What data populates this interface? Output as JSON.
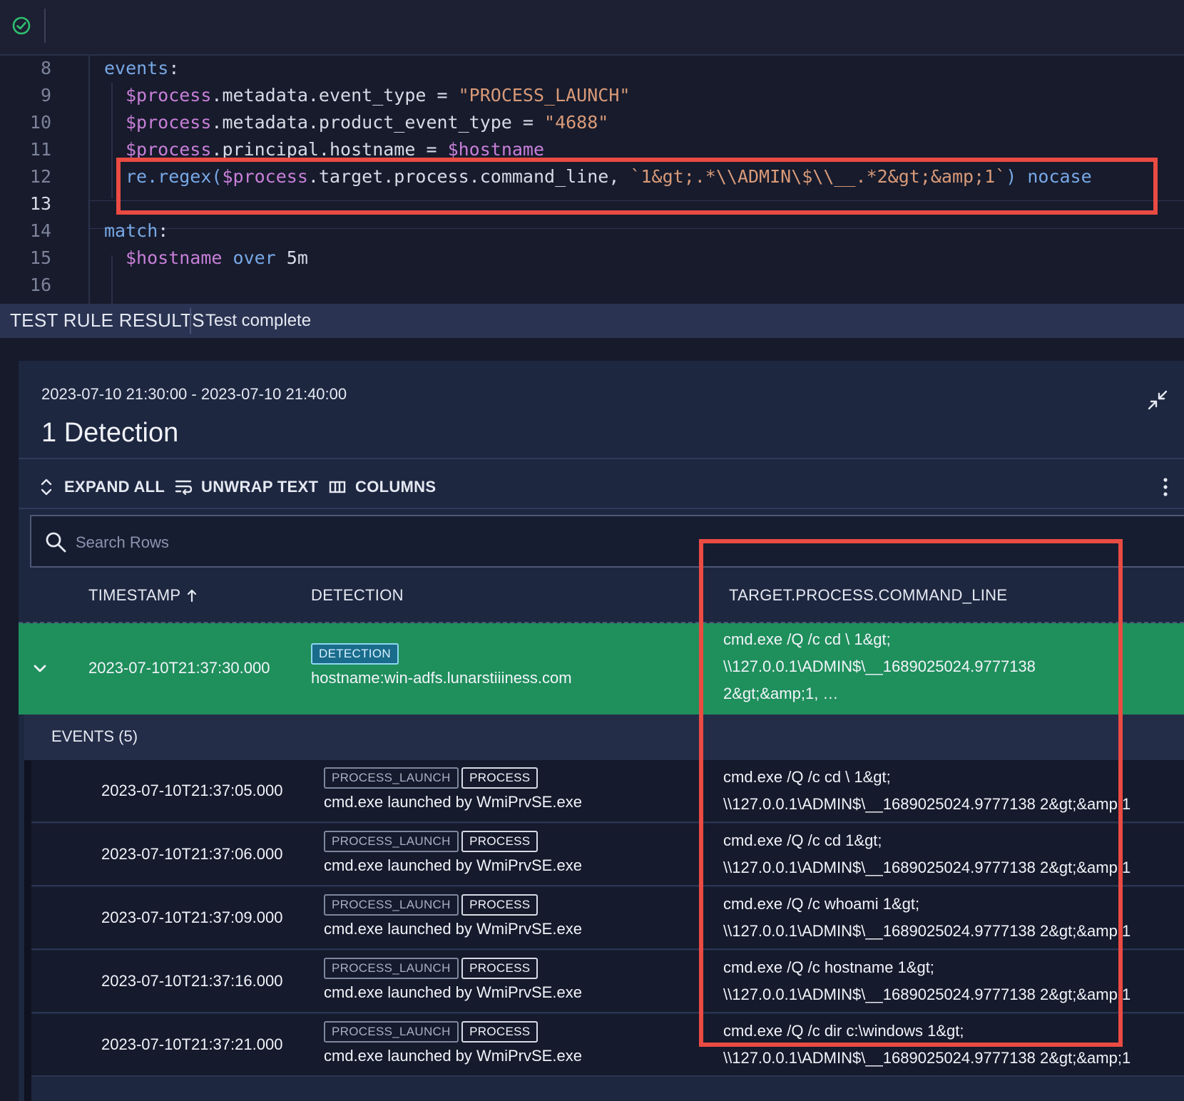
{
  "editor": {
    "lines": [
      {
        "n": "8",
        "parts": [
          {
            "t": "events",
            "c": "kw"
          },
          {
            "t": ":",
            "c": "plain"
          }
        ],
        "indent": 146
      },
      {
        "n": "9",
        "parts": [
          {
            "t": "$process",
            "c": "var"
          },
          {
            "t": ".metadata.event_type = ",
            "c": "plain"
          },
          {
            "t": "\"PROCESS_LAUNCH\"",
            "c": "str"
          }
        ],
        "indent": 176
      },
      {
        "n": "10",
        "parts": [
          {
            "t": "$process",
            "c": "var"
          },
          {
            "t": ".metadata.product_event_type = ",
            "c": "plain"
          },
          {
            "t": "\"4688\"",
            "c": "str"
          }
        ],
        "indent": 176
      },
      {
        "n": "11",
        "parts": [
          {
            "t": "$process",
            "c": "var"
          },
          {
            "t": ".principal.hostname = ",
            "c": "plain"
          },
          {
            "t": "$hostname",
            "c": "var"
          }
        ],
        "indent": 176
      },
      {
        "n": "12",
        "parts": [
          {
            "t": "re.regex(",
            "c": "fn"
          },
          {
            "t": "$process",
            "c": "var"
          },
          {
            "t": ".target.process.command_line, ",
            "c": "plain"
          },
          {
            "t": "`1&gt;.*\\\\ADMIN\\$\\\\__.*2&gt;&amp;1`",
            "c": "str"
          },
          {
            "t": ")",
            "c": "fn"
          },
          {
            "t": " nocase",
            "c": "kw"
          }
        ],
        "indent": 176
      },
      {
        "n": "13",
        "parts": [],
        "indent": 176,
        "active": true
      },
      {
        "n": "14",
        "parts": [
          {
            "t": "match",
            "c": "kw"
          },
          {
            "t": ":",
            "c": "plain"
          }
        ],
        "indent": 146
      },
      {
        "n": "15",
        "parts": [
          {
            "t": "$hostname",
            "c": "var"
          },
          {
            "t": " over ",
            "c": "kw"
          },
          {
            "t": "5m",
            "c": "plain"
          }
        ],
        "indent": 176
      },
      {
        "n": "16",
        "parts": [],
        "indent": 146
      }
    ]
  },
  "results": {
    "title": "TEST RULE RESULTS",
    "status": "Test complete"
  },
  "panel": {
    "time_range": "2023-07-10 21:30:00 - 2023-07-10 21:40:00",
    "detection_count": "1 Detection",
    "toolbar": {
      "expand_all": "EXPAND ALL",
      "unwrap_text": "UNWRAP TEXT",
      "columns": "COLUMNS"
    },
    "search": {
      "placeholder": "Search Rows",
      "value": ""
    },
    "columns": {
      "timestamp": "TIMESTAMP",
      "detection": "DETECTION",
      "command_line": "TARGET.PROCESS.COMMAND_LINE"
    },
    "detection_row": {
      "timestamp": "2023-07-10T21:37:30.000",
      "badge": "DETECTION",
      "description": "hostname:win-adfs.lunarstiiiness.com",
      "command_line_1": "cmd.exe /Q /c cd \\ 1&gt;",
      "command_line_2": "\\\\127.0.0.1\\ADMIN$\\__1689025024.9777138",
      "command_line_3": "2&gt;&amp;1, …"
    },
    "events_label": "EVENTS (5)",
    "events": [
      {
        "timestamp": "2023-07-10T21:37:05.000",
        "badge1": "PROCESS_LAUNCH",
        "badge2": "PROCESS",
        "description": "cmd.exe launched by WmiPrvSE.exe",
        "cmd1": "cmd.exe /Q /c cd \\ 1&gt;",
        "cmd2": "\\\\127.0.0.1\\ADMIN$\\__1689025024.9777138 2&gt;&amp;1"
      },
      {
        "timestamp": "2023-07-10T21:37:06.000",
        "badge1": "PROCESS_LAUNCH",
        "badge2": "PROCESS",
        "description": "cmd.exe launched by WmiPrvSE.exe",
        "cmd1": "cmd.exe /Q /c cd 1&gt;",
        "cmd2": "\\\\127.0.0.1\\ADMIN$\\__1689025024.9777138 2&gt;&amp;1"
      },
      {
        "timestamp": "2023-07-10T21:37:09.000",
        "badge1": "PROCESS_LAUNCH",
        "badge2": "PROCESS",
        "description": "cmd.exe launched by WmiPrvSE.exe",
        "cmd1": "cmd.exe /Q /c whoami 1&gt;",
        "cmd2": "\\\\127.0.0.1\\ADMIN$\\__1689025024.9777138 2&gt;&amp;1"
      },
      {
        "timestamp": "2023-07-10T21:37:16.000",
        "badge1": "PROCESS_LAUNCH",
        "badge2": "PROCESS",
        "description": "cmd.exe launched by WmiPrvSE.exe",
        "cmd1": "cmd.exe /Q /c hostname 1&gt;",
        "cmd2": "\\\\127.0.0.1\\ADMIN$\\__1689025024.9777138 2&gt;&amp;1"
      },
      {
        "timestamp": "2023-07-10T21:37:21.000",
        "badge1": "PROCESS_LAUNCH",
        "badge2": "PROCESS",
        "description": "cmd.exe launched by WmiPrvSE.exe",
        "cmd1": "cmd.exe /Q /c dir c:\\windows 1&gt;",
        "cmd2": "\\\\127.0.0.1\\ADMIN$\\__1689025024.9777138 2&gt;&amp;1"
      }
    ]
  },
  "colors": {
    "accent_highlight": "#ea4b42",
    "detection_row": "#1f8f5c",
    "status_ok": "#2fbf71"
  }
}
